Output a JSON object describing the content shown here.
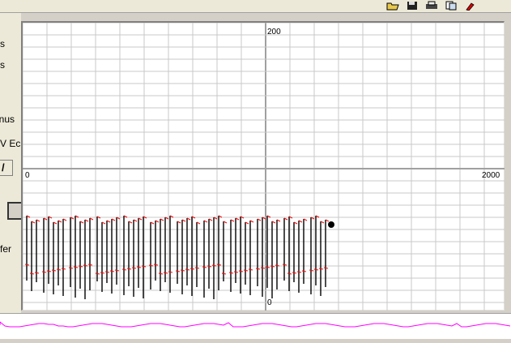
{
  "left_panel": {
    "labels": [
      "s",
      "s",
      "inus",
      "V Ec",
      "fer"
    ],
    "button1_label": "/"
  },
  "toolbar": {
    "icons": [
      "open-folder-icon",
      "save-icon",
      "print-icon",
      "copy-icon",
      "marker-icon"
    ]
  },
  "plot": {
    "y_top_label": "200",
    "y_bottom_label": "0",
    "x_left_label": "0",
    "x_right_label": "2000",
    "trace_color": "#000000",
    "marker_color": "#ff0000",
    "grid_color": "#c8c8c8",
    "center_line_color": "#a0a0a0"
  },
  "bottom_strip": {
    "trace_color": "#ff00ff"
  }
}
